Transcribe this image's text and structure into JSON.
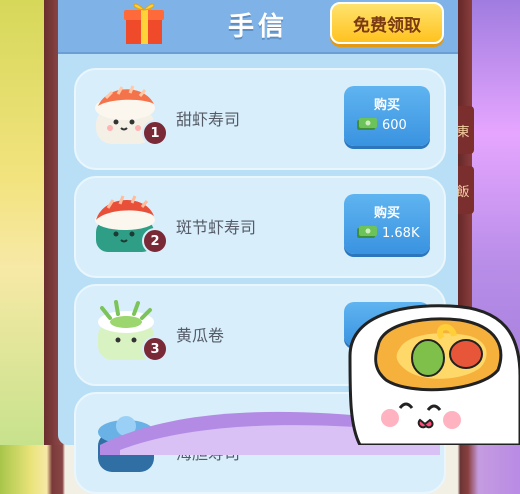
{
  "header": {
    "title": "手信",
    "free_button_label": "免费领取"
  },
  "items": [
    {
      "name": "甜虾寿司",
      "level": "1",
      "buy_label": "购买",
      "price": "600"
    },
    {
      "name": "斑节虾寿司",
      "level": "2",
      "buy_label": "购买",
      "price": "1.68K"
    },
    {
      "name": "黄瓜卷",
      "level": "3"
    },
    {
      "name": "海胆寿司"
    }
  ],
  "side_labels": [
    "東",
    "飯"
  ],
  "colors": {
    "panel": "#b9dff6",
    "header": "#7fb2e6",
    "buy_button": "#3a93e0",
    "free_button": "#ffc21f",
    "badge": "#7a2a36"
  },
  "icons": {
    "gift": "gift-box-icon",
    "cash": "cash-stack-icon"
  }
}
